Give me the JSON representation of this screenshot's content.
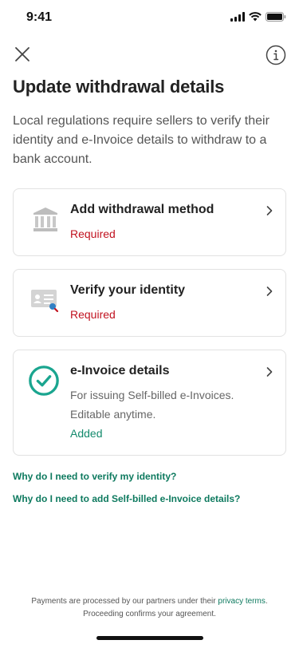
{
  "status_bar": {
    "time": "9:41"
  },
  "header": {
    "close_icon": "close-icon",
    "info_icon": "info-icon"
  },
  "page": {
    "title": "Update withdrawal details",
    "description": "Local regulations require sellers to verify their identity and e-Invoice details to withdraw to a bank account."
  },
  "cards": [
    {
      "title": "Add withdrawal method",
      "status": "Required",
      "icon": "bank-icon"
    },
    {
      "title": "Verify your identity",
      "status": "Required",
      "icon": "id-card-icon"
    },
    {
      "title": "e-Invoice details",
      "description": "For issuing Self-billed e-Invoices. Editable anytime.",
      "status": "Added",
      "icon": "check-circle-icon"
    }
  ],
  "help_links": [
    "Why do I need to verify my identity?",
    "Why do I need to add Self-billed e-Invoice details?"
  ],
  "footer": {
    "text_before": "Payments are processed by our partners under their ",
    "link": "privacy terms",
    "text_after": ".",
    "line2": "Proceeding confirms your agreement."
  },
  "colors": {
    "required": "#c1121f",
    "added": "#138a6c",
    "link": "#0e7a5f",
    "check": "#1aa58f"
  }
}
